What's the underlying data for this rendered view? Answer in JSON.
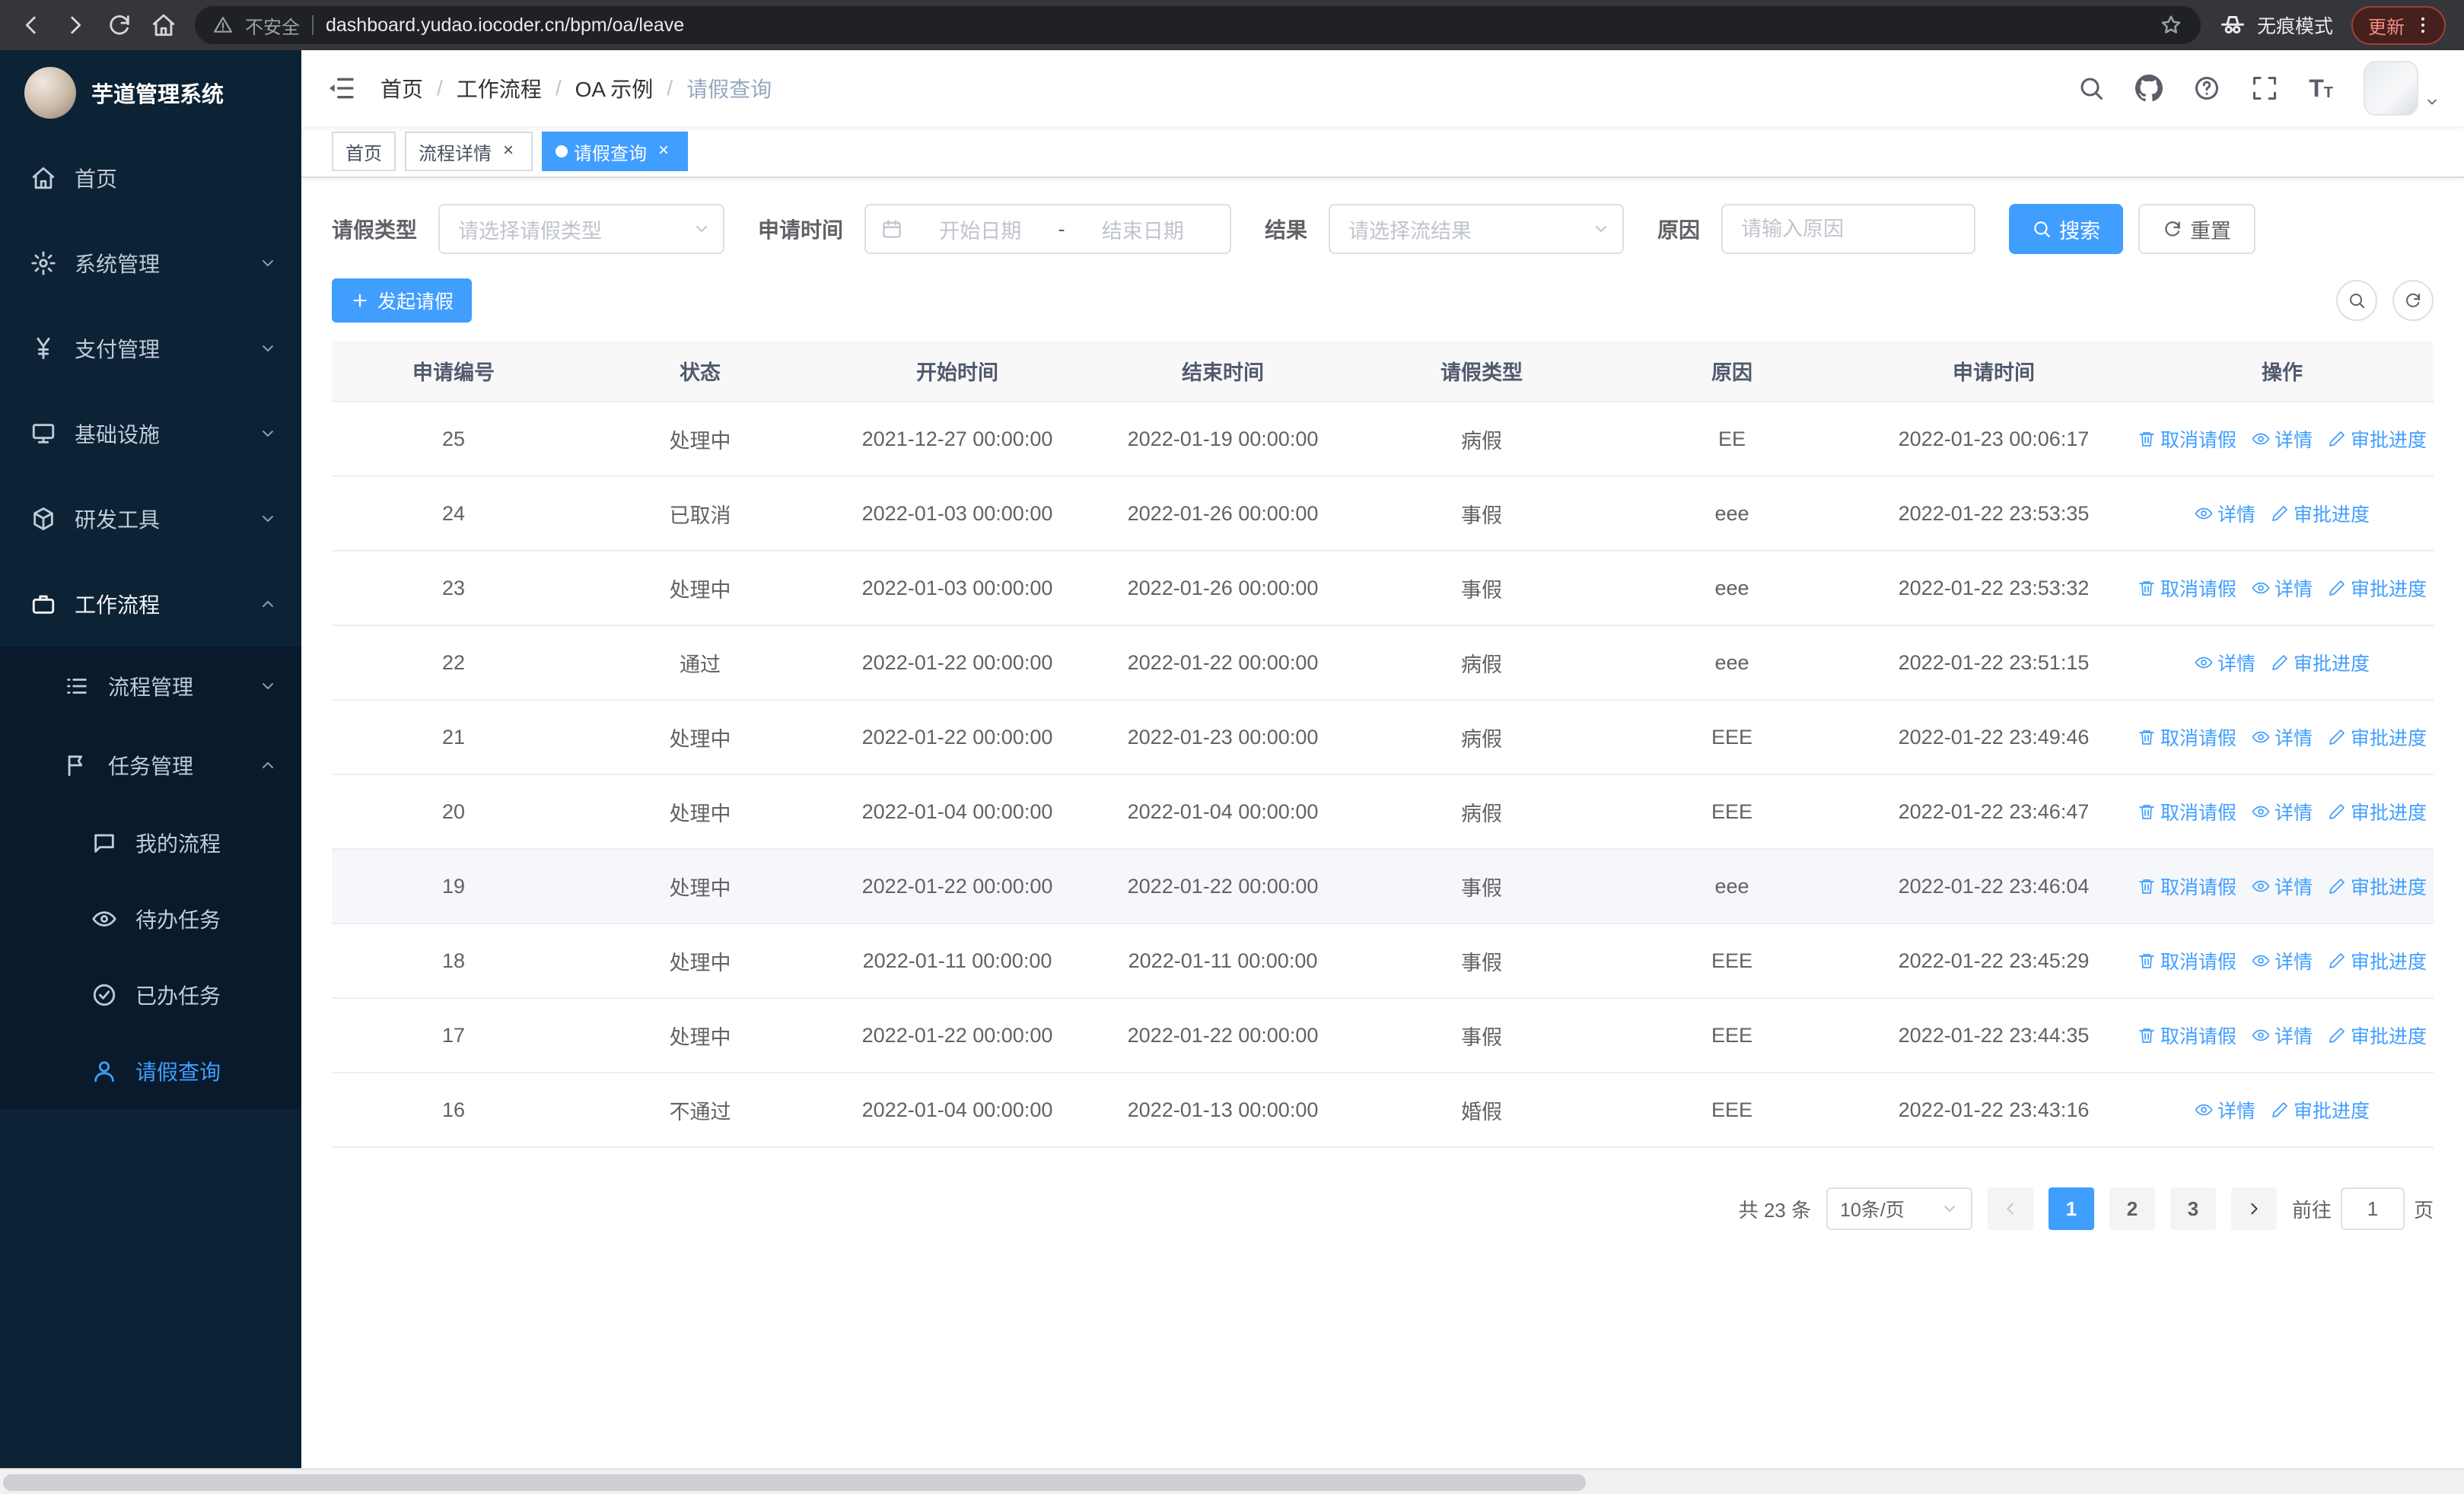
{
  "browser": {
    "security_label": "不安全",
    "url": "dashboard.yudao.iocoder.cn/bpm/oa/leave",
    "incognito_label": "无痕模式",
    "update_label": "更新"
  },
  "sidebar": {
    "logo_title": "芋道管理系统",
    "menu": [
      {
        "label": "首页"
      },
      {
        "label": "系统管理"
      },
      {
        "label": "支付管理"
      },
      {
        "label": "基础设施"
      },
      {
        "label": "研发工具"
      },
      {
        "label": "工作流程"
      }
    ],
    "submenu": [
      {
        "label": "流程管理"
      },
      {
        "label": "任务管理"
      }
    ],
    "task_children": [
      {
        "label": "我的流程"
      },
      {
        "label": "待办任务"
      },
      {
        "label": "已办任务"
      },
      {
        "label": "请假查询"
      }
    ]
  },
  "navbar": {
    "breadcrumb": [
      "首页",
      "工作流程",
      "OA 示例",
      "请假查询"
    ],
    "separator": "/"
  },
  "tags": [
    {
      "label": "首页"
    },
    {
      "label": "流程详情"
    },
    {
      "label": "请假查询"
    }
  ],
  "filters": {
    "leave_type_label": "请假类型",
    "leave_type_placeholder": "请选择请假类型",
    "apply_time_label": "申请时间",
    "start_date_placeholder": "开始日期",
    "range_separator": "-",
    "end_date_placeholder": "结束日期",
    "result_label": "结果",
    "result_placeholder": "请选择流结果",
    "reason_label": "原因",
    "reason_placeholder": "请输入原因",
    "search_button": "搜索",
    "reset_button": "重置"
  },
  "toolbar": {
    "create_button": "发起请假"
  },
  "table": {
    "columns": [
      "申请编号",
      "状态",
      "开始时间",
      "结束时间",
      "请假类型",
      "原因",
      "申请时间",
      "操作"
    ],
    "action_labels": {
      "cancel": "取消请假",
      "detail": "详情",
      "progress": "审批进度"
    },
    "rows": [
      {
        "id": "25",
        "status": "处理中",
        "start": "2021-12-27 00:00:00",
        "end": "2022-01-19 00:00:00",
        "type": "病假",
        "reason": "EE",
        "applied": "2022-01-23 00:06:17",
        "actions": [
          "cancel",
          "detail",
          "progress"
        ],
        "highlighted": false
      },
      {
        "id": "24",
        "status": "已取消",
        "start": "2022-01-03 00:00:00",
        "end": "2022-01-26 00:00:00",
        "type": "事假",
        "reason": "eee",
        "applied": "2022-01-22 23:53:35",
        "actions": [
          "detail",
          "progress"
        ],
        "highlighted": false
      },
      {
        "id": "23",
        "status": "处理中",
        "start": "2022-01-03 00:00:00",
        "end": "2022-01-26 00:00:00",
        "type": "事假",
        "reason": "eee",
        "applied": "2022-01-22 23:53:32",
        "actions": [
          "cancel",
          "detail",
          "progress"
        ],
        "highlighted": false
      },
      {
        "id": "22",
        "status": "通过",
        "start": "2022-01-22 00:00:00",
        "end": "2022-01-22 00:00:00",
        "type": "病假",
        "reason": "eee",
        "applied": "2022-01-22 23:51:15",
        "actions": [
          "detail",
          "progress"
        ],
        "highlighted": false
      },
      {
        "id": "21",
        "status": "处理中",
        "start": "2022-01-22 00:00:00",
        "end": "2022-01-23 00:00:00",
        "type": "病假",
        "reason": "EEE",
        "applied": "2022-01-22 23:49:46",
        "actions": [
          "cancel",
          "detail",
          "progress"
        ],
        "highlighted": false
      },
      {
        "id": "20",
        "status": "处理中",
        "start": "2022-01-04 00:00:00",
        "end": "2022-01-04 00:00:00",
        "type": "病假",
        "reason": "EEE",
        "applied": "2022-01-22 23:46:47",
        "actions": [
          "cancel",
          "detail",
          "progress"
        ],
        "highlighted": false
      },
      {
        "id": "19",
        "status": "处理中",
        "start": "2022-01-22 00:00:00",
        "end": "2022-01-22 00:00:00",
        "type": "事假",
        "reason": "eee",
        "applied": "2022-01-22 23:46:04",
        "actions": [
          "cancel",
          "detail",
          "progress"
        ],
        "highlighted": true
      },
      {
        "id": "18",
        "status": "处理中",
        "start": "2022-01-11 00:00:00",
        "end": "2022-01-11 00:00:00",
        "type": "事假",
        "reason": "EEE",
        "applied": "2022-01-22 23:45:29",
        "actions": [
          "cancel",
          "detail",
          "progress"
        ],
        "highlighted": false
      },
      {
        "id": "17",
        "status": "处理中",
        "start": "2022-01-22 00:00:00",
        "end": "2022-01-22 00:00:00",
        "type": "事假",
        "reason": "EEE",
        "applied": "2022-01-22 23:44:35",
        "actions": [
          "cancel",
          "detail",
          "progress"
        ],
        "highlighted": false
      },
      {
        "id": "16",
        "status": "不通过",
        "start": "2022-01-04 00:00:00",
        "end": "2022-01-13 00:00:00",
        "type": "婚假",
        "reason": "EEE",
        "applied": "2022-01-22 23:43:16",
        "actions": [
          "detail",
          "progress"
        ],
        "highlighted": false
      }
    ]
  },
  "pagination": {
    "total": "共 23 条",
    "page_size": "10条/页",
    "pages": [
      "1",
      "2",
      "3"
    ],
    "active_page": "1",
    "goto_label": "前往",
    "goto_value": "1",
    "goto_suffix": "页"
  }
}
